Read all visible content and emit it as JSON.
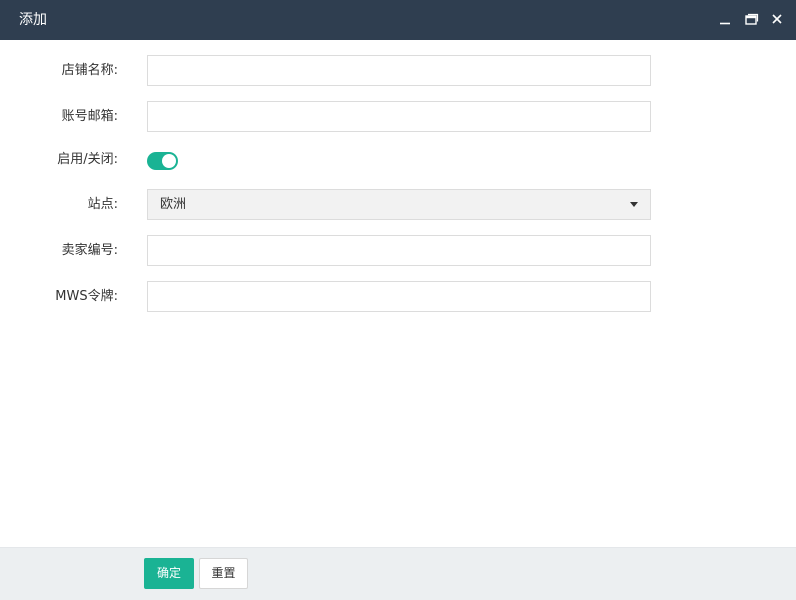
{
  "window": {
    "title": "添加",
    "controls": [
      "minimize-icon",
      "maximize-icon",
      "close-icon"
    ]
  },
  "form": {
    "shop_name": {
      "label": "店铺名称:",
      "value": "",
      "placeholder": ""
    },
    "account_email": {
      "label": "账号邮箱:",
      "value": "",
      "placeholder": ""
    },
    "enable": {
      "label": "启用/关闭:",
      "checked": true,
      "accent": "#1ab394"
    },
    "site": {
      "label": "站点:",
      "selected": "欧洲"
    },
    "seller_id": {
      "label": "卖家编号:",
      "value": "",
      "placeholder": ""
    },
    "mws_token": {
      "label": "MWS令牌:",
      "value": "",
      "placeholder": ""
    }
  },
  "footer": {
    "confirm_label": "确定",
    "reset_label": "重置"
  },
  "colors": {
    "titlebar": "#2f3e50",
    "primary": "#1ab394",
    "footer_bg": "#eceff1"
  }
}
